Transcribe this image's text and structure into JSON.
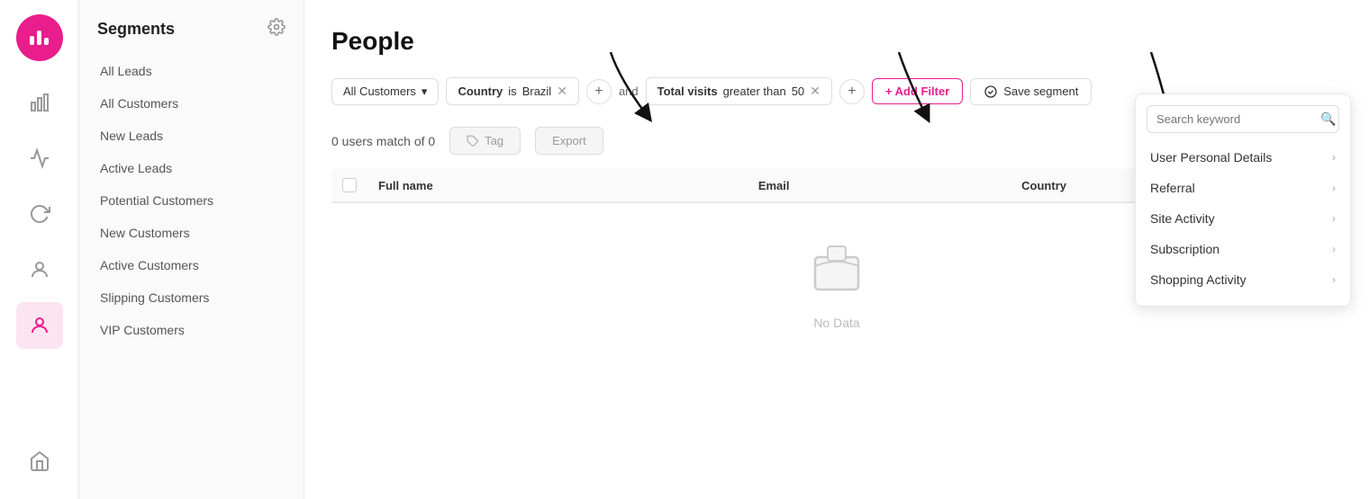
{
  "app": {
    "logo_alt": "App Logo"
  },
  "icon_sidebar": {
    "nav_items": [
      {
        "id": "dashboard",
        "icon": "bar-chart",
        "active": false
      },
      {
        "id": "analytics",
        "icon": "chart",
        "active": false
      },
      {
        "id": "sync",
        "icon": "sync",
        "active": false
      },
      {
        "id": "user-circle",
        "icon": "user-circle",
        "active": false
      },
      {
        "id": "people",
        "icon": "people",
        "active": true
      },
      {
        "id": "home",
        "icon": "home",
        "active": false
      }
    ]
  },
  "left_sidebar": {
    "title": "Segments",
    "nav_items": [
      {
        "label": "All Leads",
        "active": false
      },
      {
        "label": "All Customers",
        "active": false
      },
      {
        "label": "New Leads",
        "active": false
      },
      {
        "label": "Active Leads",
        "active": false
      },
      {
        "label": "Potential Customers",
        "active": false
      },
      {
        "label": "New Customers",
        "active": false
      },
      {
        "label": "Active Customers",
        "active": false
      },
      {
        "label": "Slipping Customers",
        "active": false
      },
      {
        "label": "VIP Customers",
        "active": false
      }
    ]
  },
  "main": {
    "page_title": "People",
    "filter_segment_label": "All Customers",
    "filter_segment_chevron": "▾",
    "filter1": {
      "field": "Country",
      "operator": "is",
      "value": "Brazil"
    },
    "filter2": {
      "field": "Total visits",
      "operator": "greater than",
      "value": "50"
    },
    "and_label": "and",
    "add_filter_label": "+ Add Filter",
    "save_segment_label": "Save segment",
    "match_text": "0 users match of 0",
    "tag_btn": "Tag",
    "export_btn": "Export",
    "table": {
      "columns": [
        "Full name",
        "Email",
        "Country"
      ]
    },
    "no_data_text": "No Data"
  },
  "dropdown": {
    "search_placeholder": "Search keyword",
    "items": [
      {
        "label": "User Personal Details",
        "has_arrow": true
      },
      {
        "label": "Referral",
        "has_arrow": true
      },
      {
        "label": "Site Activity",
        "has_arrow": true
      },
      {
        "label": "Subscription",
        "has_arrow": true
      },
      {
        "label": "Shopping Activity",
        "has_arrow": true
      }
    ]
  }
}
